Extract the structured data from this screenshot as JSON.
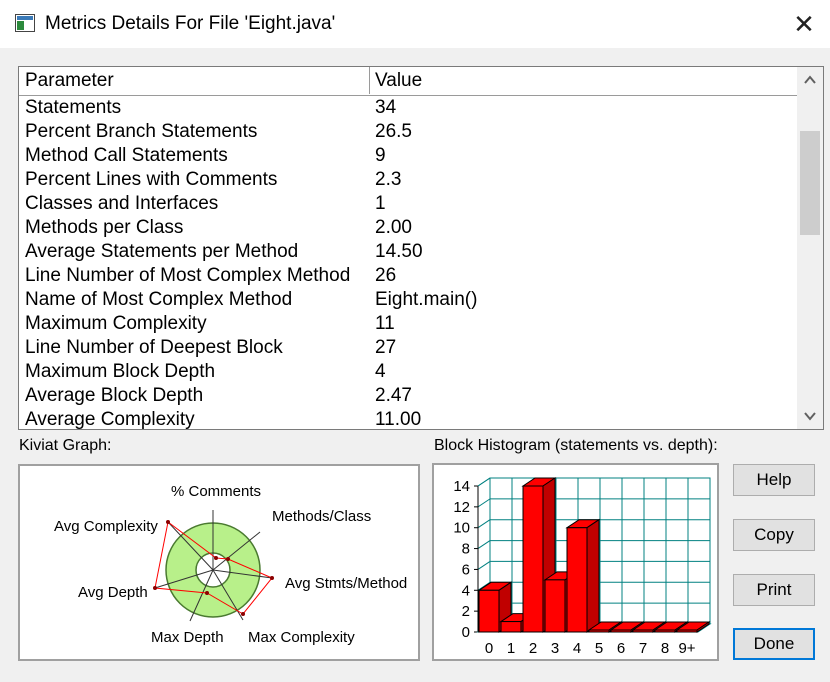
{
  "window": {
    "title": "Metrics Details For File 'Eight.java'",
    "close_glyph": "✕"
  },
  "table": {
    "headers": [
      "Parameter",
      "Value"
    ],
    "rows": [
      {
        "param": "Statements",
        "value": "34"
      },
      {
        "param": "Percent Branch Statements",
        "value": "26.5"
      },
      {
        "param": "Method Call Statements",
        "value": "9"
      },
      {
        "param": "Percent Lines with Comments",
        "value": "2.3"
      },
      {
        "param": "Classes and Interfaces",
        "value": "1"
      },
      {
        "param": "Methods per Class",
        "value": "2.00"
      },
      {
        "param": "Average Statements per Method",
        "value": "14.50"
      },
      {
        "param": "Line Number of Most Complex Method",
        "value": "26"
      },
      {
        "param": "Name of Most Complex Method",
        "value": "Eight.main()"
      },
      {
        "param": "Maximum Complexity",
        "value": "11"
      },
      {
        "param": "Line Number of Deepest Block",
        "value": "27"
      },
      {
        "param": "Maximum Block Depth",
        "value": "4"
      },
      {
        "param": "Average Block Depth",
        "value": "2.47"
      },
      {
        "param": "Average Complexity",
        "value": "11.00"
      }
    ]
  },
  "kiviat": {
    "caption": "Kiviat Graph:",
    "axes": [
      "% Comments",
      "Methods/Class",
      "Avg Stmts/Method",
      "Max Complexity",
      "Max Depth",
      "Avg Depth",
      "Avg Complexity"
    ]
  },
  "histogram": {
    "caption": "Block Histogram (statements vs. depth):",
    "y_ticks": [
      "0",
      "2",
      "4",
      "6",
      "8",
      "10",
      "12",
      "14"
    ],
    "categories": [
      "0",
      "1",
      "2",
      "3",
      "4",
      "5",
      "6",
      "7",
      "8",
      "9+"
    ],
    "values": [
      4,
      1,
      14,
      5,
      10,
      0,
      0,
      0,
      0,
      0
    ],
    "ylim": [
      0,
      14
    ],
    "bar_color": "#ff0000",
    "grid_color": "#008080"
  },
  "buttons": {
    "help": "Help",
    "copy": "Copy",
    "print": "Print",
    "done": "Done"
  },
  "scroll": {
    "up_glyph": "⌃",
    "down_glyph": "⌄"
  }
}
